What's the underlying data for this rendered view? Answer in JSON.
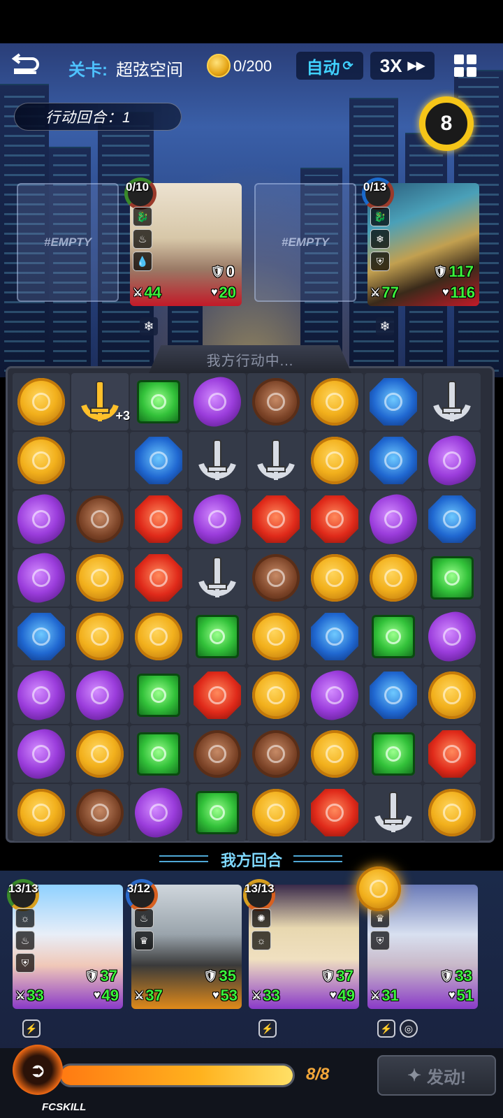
{
  "hud": {
    "stage_label": "关卡:",
    "stage_name": "超弦空间",
    "coins": "0/200",
    "auto_label": "自动",
    "speed_label": "3X",
    "turn_label": "行动回合：1",
    "energy": "8"
  },
  "enemies": {
    "slot1": "#EMPTY",
    "slot3": "#EMPTY",
    "enemy1": {
      "charge": "0/10",
      "shield": "0",
      "attack": "44",
      "hp": "20"
    },
    "enemy2": {
      "charge": "0/13",
      "shield": "117",
      "attack": "77",
      "hp": "116"
    }
  },
  "board": {
    "header": "我方行动中...",
    "footer": "我方回合",
    "drop_bonus": "+3",
    "rows": [
      [
        "yellow",
        "sword-gold",
        "green",
        "purple",
        "brown",
        "yellow",
        "blue",
        "sword"
      ],
      [
        "yellow",
        "empty",
        "blue",
        "sword",
        "sword",
        "yellow",
        "blue",
        "purple"
      ],
      [
        "purple",
        "brown",
        "red",
        "purple",
        "red",
        "red",
        "purple",
        "blue"
      ],
      [
        "purple",
        "yellow",
        "red",
        "sword",
        "brown",
        "yellow",
        "yellow",
        "green"
      ],
      [
        "blue",
        "yellow",
        "yellow",
        "green",
        "yellow",
        "blue",
        "green",
        "purple"
      ],
      [
        "purple",
        "purple",
        "green",
        "red",
        "yellow",
        "purple",
        "blue",
        "yellow"
      ],
      [
        "purple",
        "yellow",
        "green",
        "brown",
        "brown",
        "yellow",
        "green",
        "red"
      ],
      [
        "yellow",
        "brown",
        "purple",
        "green",
        "yellow",
        "red",
        "sword",
        "yellow"
      ]
    ]
  },
  "party": [
    {
      "charge": "13/13",
      "shield": "37",
      "attack": "33",
      "hp": "49"
    },
    {
      "charge": "3/12",
      "shield": "35",
      "attack": "37",
      "hp": "53"
    },
    {
      "charge": "13/13",
      "shield": "37",
      "attack": "33",
      "hp": "49"
    },
    {
      "charge": "",
      "shield": "33",
      "attack": "31",
      "hp": "51"
    }
  ],
  "fcskill": {
    "label": "FCSKILL",
    "count": "8/8",
    "fill_fraction": 1.0,
    "fire_label": "发动!"
  },
  "colors": {
    "accent_blue": "#4ec3ff",
    "stat_green": "#3cf23c",
    "gold": "#f5c518"
  }
}
